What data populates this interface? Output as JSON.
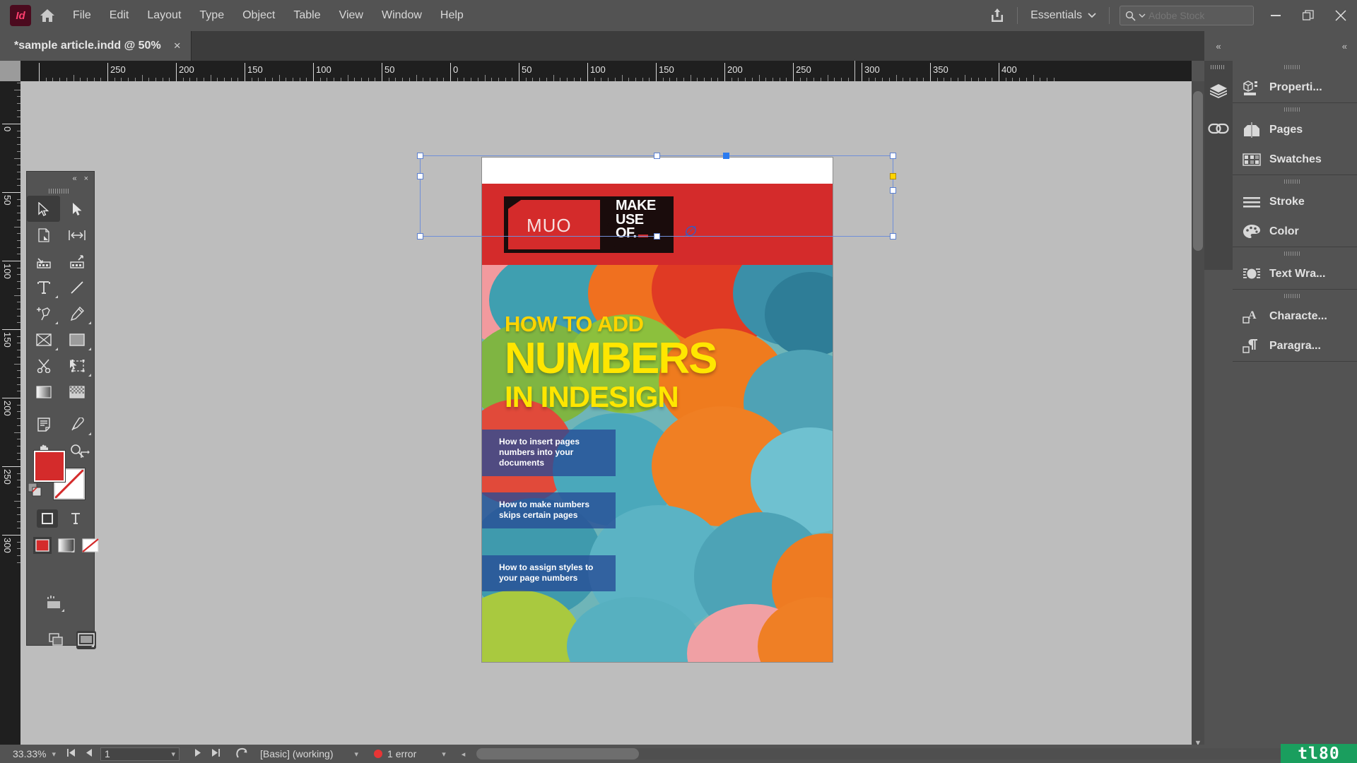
{
  "app": {
    "logo_text": "Id",
    "menus": [
      "File",
      "Edit",
      "Layout",
      "Type",
      "Object",
      "Table",
      "View",
      "Window",
      "Help"
    ],
    "workspace": "Essentials",
    "search_placeholder": "Adobe Stock",
    "window_buttons": [
      "minimize",
      "restore",
      "close"
    ]
  },
  "tab": {
    "title": "*sample article.indd @ 50%",
    "close": "×"
  },
  "rulers": {
    "horizontal_labels": [
      "250",
      "200",
      "150",
      "100",
      "50",
      "0",
      "50",
      "100",
      "150",
      "200",
      "250",
      "300",
      "350",
      "400"
    ],
    "vertical_labels": [
      "0",
      "50",
      "100",
      "150",
      "200",
      "250",
      "300"
    ],
    "unit": "mm"
  },
  "toolbar": {
    "collapse": "«",
    "close": "×",
    "tools": [
      {
        "name": "selection-tool",
        "active": true
      },
      {
        "name": "direct-selection-tool",
        "active": false
      },
      {
        "name": "page-tool",
        "active": false
      },
      {
        "name": "gap-tool",
        "active": false
      },
      {
        "name": "content-collector-tool",
        "active": false
      },
      {
        "name": "content-placer-tool",
        "active": false
      },
      {
        "name": "type-tool",
        "active": false
      },
      {
        "name": "line-tool",
        "active": false
      },
      {
        "name": "pen-tool",
        "active": false
      },
      {
        "name": "pencil-tool",
        "active": false
      },
      {
        "name": "frame-tool",
        "active": false
      },
      {
        "name": "rectangle-tool",
        "active": false
      },
      {
        "name": "scissors-tool",
        "active": false
      },
      {
        "name": "free-transform-tool",
        "active": false
      },
      {
        "name": "gradient-swatch-tool",
        "active": false
      },
      {
        "name": "gradient-feather-tool",
        "active": false
      },
      {
        "name": "note-tool",
        "active": false
      },
      {
        "name": "eyedropper-tool",
        "active": false
      },
      {
        "name": "hand-tool",
        "active": false
      },
      {
        "name": "zoom-tool",
        "active": false
      }
    ],
    "fill_color": "#d42b2b",
    "stroke_color": "#ffffff",
    "stroke_is_none": true
  },
  "dock": {
    "collapse_left": "«",
    "collapse_right": "«",
    "narrow_icons": [
      "layers-icon",
      "links-icon"
    ],
    "groups": [
      {
        "items": [
          {
            "label": "Properti...",
            "icon": "properties-icon"
          }
        ]
      },
      {
        "items": [
          {
            "label": "Pages",
            "icon": "pages-icon"
          },
          {
            "label": "Swatches",
            "icon": "swatches-icon"
          }
        ]
      },
      {
        "items": [
          {
            "label": "Stroke",
            "icon": "stroke-icon"
          },
          {
            "label": "Color",
            "icon": "color-icon"
          }
        ]
      },
      {
        "items": [
          {
            "label": "Text Wra...",
            "icon": "text-wrap-icon"
          }
        ]
      },
      {
        "items": [
          {
            "label": "Characte...",
            "icon": "character-icon"
          },
          {
            "label": "Paragra...",
            "icon": "paragraph-icon"
          }
        ]
      }
    ]
  },
  "document": {
    "header_band_color": "#d42b2b",
    "logo": {
      "mark": "MUO",
      "line1": "MAKE",
      "line2": "USE",
      "line3": "OF."
    },
    "cover": {
      "title_line1": "HOW TO ADD",
      "title_line2": "NUMBERS",
      "title_line3": "IN INDESIGN",
      "title_color": "#ffe600",
      "bullets": [
        "How to insert pages numbers into your documents",
        "How to make numbers skips certain pages",
        "How to assign styles to your page numbers"
      ],
      "bullet_bg_color": "#264c96"
    }
  },
  "status": {
    "zoom": "33.33%",
    "page_number": "1",
    "preflight_profile": "[Basic] (working)",
    "errors": "1 error",
    "nav_first": "⏮",
    "nav_prev": "◀",
    "nav_next": "▶",
    "nav_last": "⏭"
  },
  "watermark": {
    "text": "tl80",
    "color": "#1a9e5e"
  }
}
